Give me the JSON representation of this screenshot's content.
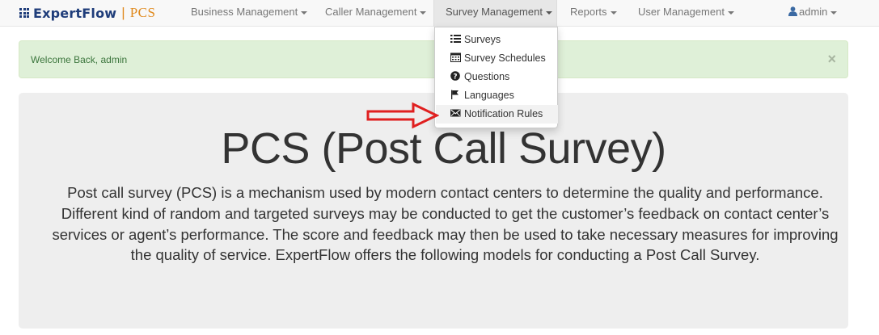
{
  "brand": {
    "name": "ExpertFlow",
    "separator": "|",
    "product": "PCS"
  },
  "nav": {
    "items": [
      {
        "label": "Business Management"
      },
      {
        "label": "Caller Management"
      },
      {
        "label": "Survey Management"
      },
      {
        "label": "Reports"
      },
      {
        "label": "User Management"
      }
    ],
    "user": {
      "label": "admin",
      "icon": "user-icon"
    }
  },
  "dropdown": {
    "items": [
      {
        "label": "Surveys",
        "icon": "list-icon"
      },
      {
        "label": "Survey Schedules",
        "icon": "calendar-icon"
      },
      {
        "label": "Questions",
        "icon": "question-circle-icon"
      },
      {
        "label": "Languages",
        "icon": "flag-icon"
      },
      {
        "label": "Notification Rules",
        "icon": "envelope-icon"
      }
    ]
  },
  "alert": {
    "text": "Welcome Back, admin",
    "close": "×"
  },
  "jumbotron": {
    "title": "PCS (Post Call Survey)",
    "text": "Post call survey (PCS) is a mechanism used by modern contact centers to determine the quality and performance. Different kind of random and targeted surveys may be conducted to get the customer’s feedback on contact center’s services or agent’s performance. The score and feedback may then be used to take necessary measures for improving the quality of service. ExpertFlow offers the following models for conducting a Post Call Survey."
  },
  "colors": {
    "brand": "#1f3d7a",
    "brand_accent": "#e08a1e",
    "alert_bg": "#dff0d8",
    "alert_text": "#3c763d",
    "arrow": "#e02020",
    "jumbotron_bg": "#eeeeee"
  }
}
